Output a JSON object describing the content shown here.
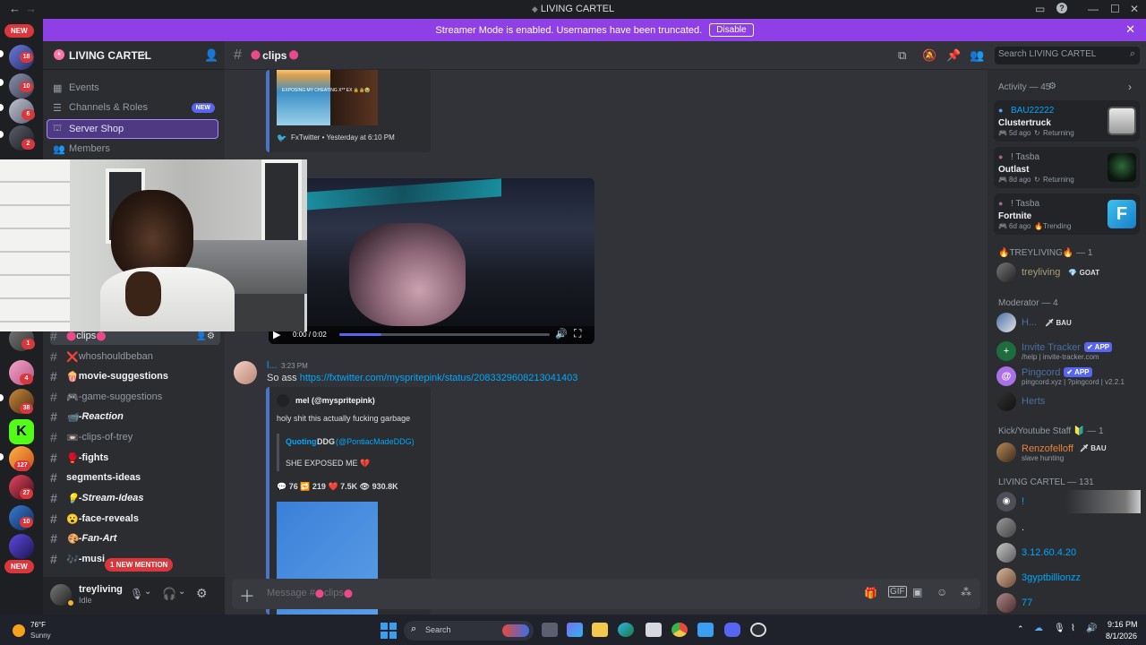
{
  "window": {
    "title": "LIVING CARTEL",
    "back": "←",
    "forward": "→"
  },
  "banner": {
    "text": "Streamer Mode is enabled. Usernames have been truncated.",
    "disable_label": "Disable"
  },
  "guilds": {
    "new_top": "NEW",
    "new_bottom": "NEW",
    "badges": [
      "18",
      "10",
      "6",
      "2",
      "1",
      "4",
      "38",
      "127",
      "27",
      "10"
    ],
    "mention_pill": "1 NEW MENTION"
  },
  "server": {
    "name": "LIVING CARTEL",
    "menu": [
      {
        "label": "Events"
      },
      {
        "label": "Channels & Roles",
        "badge": "NEW"
      },
      {
        "label": "Server Shop"
      },
      {
        "label": "Members"
      }
    ]
  },
  "channels": [
    {
      "name": "clips",
      "prefix": "",
      "state": "active"
    },
    {
      "name": "whoshouldbeban",
      "prefix": "❌",
      "state": "muted"
    },
    {
      "name": "movie-suggestions",
      "prefix": "🍿",
      "state": "unread"
    },
    {
      "name": "-game-suggestions",
      "prefix": "🎮",
      "state": "muted"
    },
    {
      "name": "-Reaction",
      "prefix": "📹",
      "state": "unread"
    },
    {
      "name": "-clips-of-trey",
      "prefix": "📼",
      "state": "muted"
    },
    {
      "name": "-fights",
      "prefix": "🥊",
      "state": "unread"
    },
    {
      "name": "segments-ideas",
      "prefix": "",
      "state": "unread"
    },
    {
      "name": "-Stream-Ideas",
      "prefix": "💡",
      "state": "unread"
    },
    {
      "name": "-face-reveals",
      "prefix": "😮",
      "state": "unread"
    },
    {
      "name": "-Fan-Art",
      "prefix": "🎨",
      "state": "unread"
    },
    {
      "name": "-musi",
      "prefix": "🎶",
      "state": "unread"
    }
  ],
  "user": {
    "name": "treyliving",
    "status": "Idle"
  },
  "chat": {
    "channel": "clips",
    "embed1": {
      "image_caption": "EXPOSING MY CHEATING X** EX 🔒🔒😭",
      "footer": "FxTwitter • Yesterday at 6:10 PM"
    },
    "video": {
      "time": "0:00 / 0:02"
    },
    "message": {
      "author": "l...",
      "time": "3:23 PM",
      "text_prefix": "So ass",
      "link": "https://fxtwitter.com/myspritepink/status/2083329608213041403"
    },
    "embed2": {
      "author": "mel (@myspritepink)",
      "text": "holy shit this actually fucking garbage",
      "quoting_label": "Quoting",
      "quoting_name": "DDG",
      "quoting_handle": "(@PontiacMadeDDG)",
      "quote_text": "SHE EXPOSED ME 💔",
      "stats": "💬 76  🔁 219  ❤️ 7.5K  👁 930.8K"
    },
    "input_placeholder": "Message #",
    "input_channel": "clips"
  },
  "search": {
    "placeholder": "Search LIVING CARTEL"
  },
  "activity": {
    "title": "Activity — 45",
    "cards": [
      {
        "user": "BAU22222",
        "game": "Clustertruck",
        "ago": "5d ago",
        "tag": "Returning"
      },
      {
        "user": "! Tasba",
        "game": "Outlast",
        "ago": "8d ago",
        "tag": "Returning"
      },
      {
        "user": "! Tasba",
        "game": "Fortnite",
        "ago": "6d ago",
        "tag": "Trending"
      }
    ]
  },
  "roles": [
    {
      "header": "🔥TREYLIVING🔥 — 1",
      "members": [
        {
          "name": "treyliving",
          "tag": "💎 GOAT",
          "sub": ""
        }
      ]
    },
    {
      "header": "Moderator — 4",
      "members": [
        {
          "name": "H...",
          "tag": "🗡 BAU",
          "sub": ""
        },
        {
          "name": "Invite Tracker",
          "tag": "✔ APP",
          "sub": "/help | invite-tracker.com"
        },
        {
          "name": "Pingcord",
          "tag": "✔ APP",
          "sub": "pingcord.xyz | ?pingcord | v2.2.1"
        },
        {
          "name": "Herts",
          "tag": "",
          "sub": ""
        }
      ]
    },
    {
      "header": "Kick/Youtube Staff 🔰 — 1",
      "members": [
        {
          "name": "Renzofelloff",
          "tag": "🗡 BAU",
          "sub": "slave hunting"
        }
      ]
    },
    {
      "header": "LIVING CARTEL — 131",
      "members": [
        {
          "name": "!",
          "tag": "",
          "sub": ""
        },
        {
          "name": ".",
          "tag": "",
          "sub": ""
        },
        {
          "name": "3.12.60.4.20",
          "tag": "",
          "sub": ""
        },
        {
          "name": "3gyptbillionzz",
          "tag": "",
          "sub": ""
        },
        {
          "name": "77",
          "tag": "",
          "sub": ""
        }
      ]
    }
  ],
  "taskbar": {
    "temp": "76°F",
    "weather": "Sunny",
    "search": "Search",
    "time": "9:16 PM",
    "date": "8/1/2026"
  },
  "colors": {
    "banner": "#8f3fe6",
    "accent": "#5865f2",
    "link": "#00a8fc"
  }
}
